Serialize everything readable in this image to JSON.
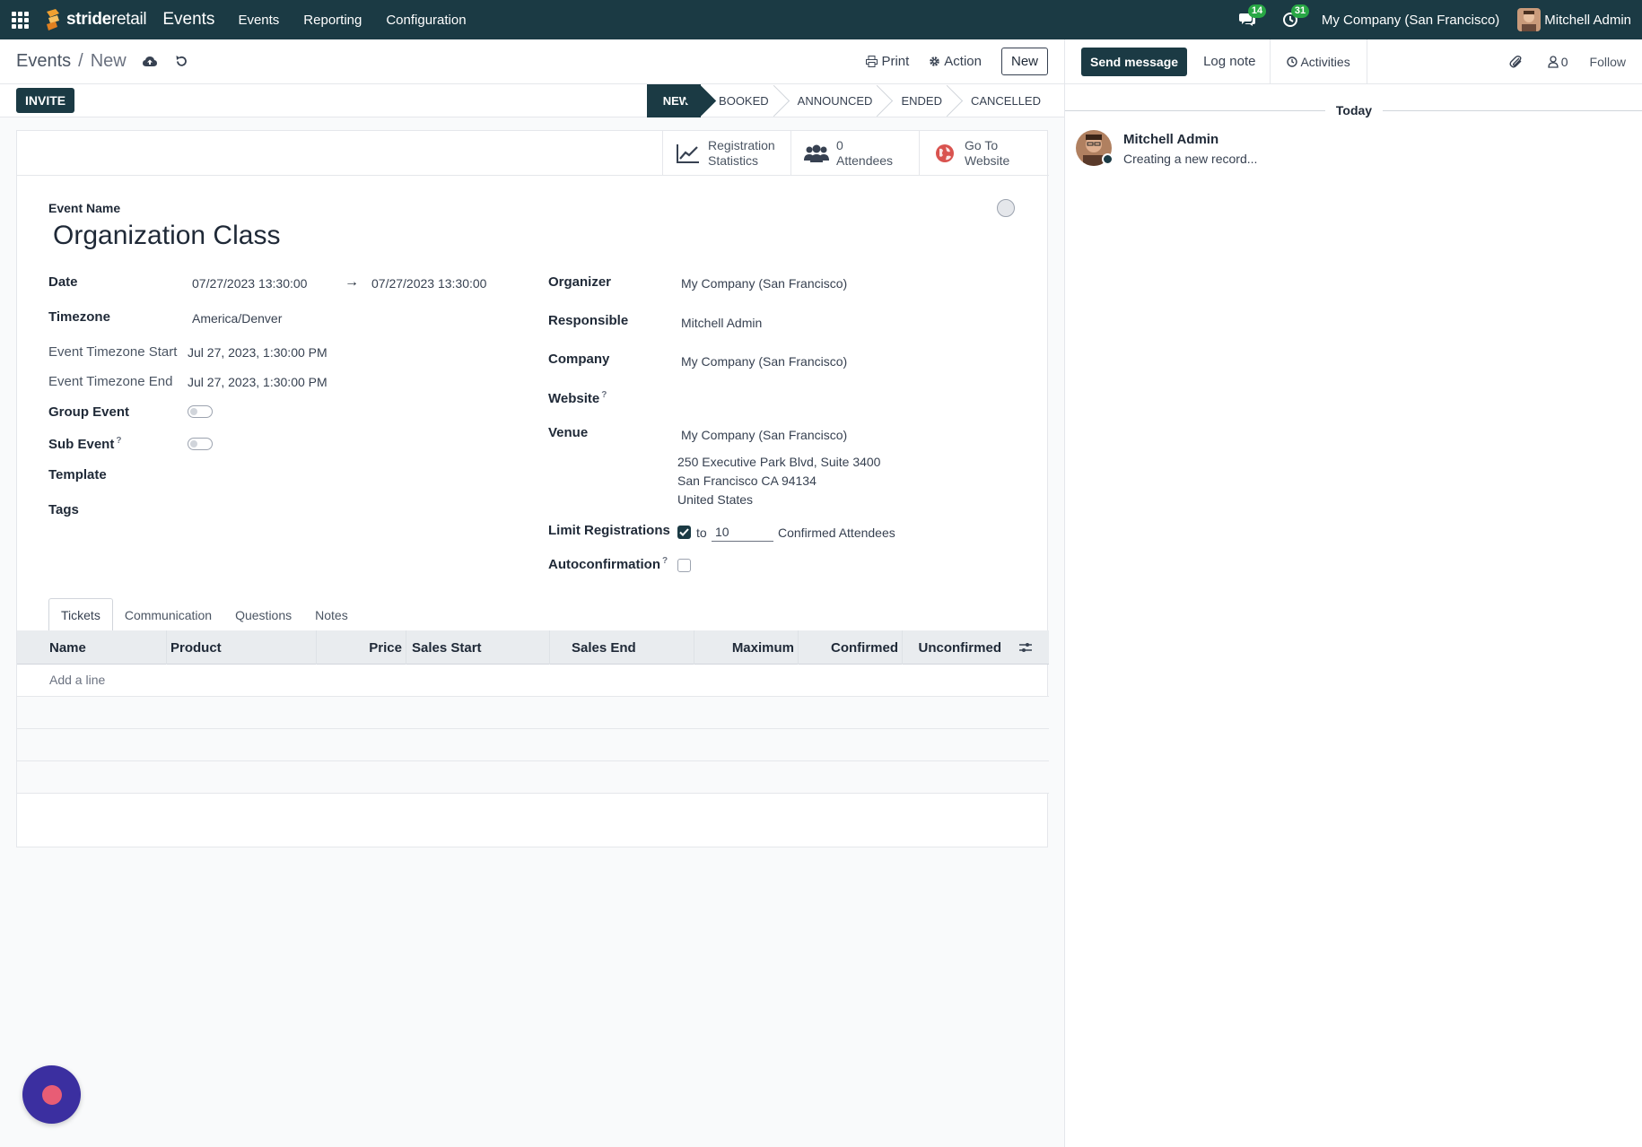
{
  "topbar": {
    "brand": "strideretail",
    "brand_part1": "stride",
    "brand_part2": "retail",
    "app_name": "Events",
    "menu": [
      "Events",
      "Reporting",
      "Configuration"
    ],
    "messages_count": "14",
    "activities_count": "31",
    "company": "My Company (San Francisco)",
    "user": "Mitchell Admin"
  },
  "control": {
    "breadcrumb_parent": "Events",
    "breadcrumb_sep": "/",
    "breadcrumb_current": "New",
    "print_label": "Print",
    "action_label": "Action",
    "new_label": "New"
  },
  "statusbar": {
    "invite_label": "INVITE",
    "stages": [
      "NEW",
      "BOOKED",
      "ANNOUNCED",
      "ENDED",
      "CANCELLED"
    ],
    "active_stage": "NEW"
  },
  "smart_buttons": {
    "stats_line1": "Registration",
    "stats_line2": "Statistics",
    "attendees_line1": "0",
    "attendees_line2": "Attendees",
    "website_line1": "Go To",
    "website_line2": "Website"
  },
  "form": {
    "event_name_label": "Event Name",
    "event_name": "Organization Class",
    "date_label": "Date",
    "date_start": "07/27/2023 13:30:00",
    "date_arrow": "→",
    "date_end": "07/27/2023 13:30:00",
    "timezone_label": "Timezone",
    "timezone": "America/Denver",
    "tz_start_label": "Event Timezone Start",
    "tz_start": "Jul 27, 2023, 1:30:00 PM",
    "tz_end_label": "Event Timezone End",
    "tz_end": "Jul 27, 2023, 1:30:00 PM",
    "group_event_label": "Group Event",
    "group_event": false,
    "sub_event_label": "Sub Event",
    "sub_event": false,
    "template_label": "Template",
    "tags_label": "Tags",
    "organizer_label": "Organizer",
    "organizer": "My Company (San Francisco)",
    "responsible_label": "Responsible",
    "responsible": "Mitchell Admin",
    "company_label": "Company",
    "company": "My Company (San Francisco)",
    "website_label": "Website",
    "venue_label": "Venue",
    "venue": "My Company (San Francisco)",
    "venue_address": [
      "250 Executive Park Blvd, Suite 3400",
      "San Francisco CA 94134",
      "United States"
    ],
    "limit_label": "Limit Registrations",
    "limit_enabled": true,
    "limit_to": "to",
    "limit_value": "10",
    "limit_suffix": "Confirmed Attendees",
    "autoconfirm_label": "Autoconfirmation",
    "autoconfirm": false,
    "help_mark": "?"
  },
  "tabs": [
    "Tickets",
    "Communication",
    "Questions",
    "Notes"
  ],
  "active_tab": "Tickets",
  "tickets_table": {
    "columns": [
      "Name",
      "Product",
      "Price",
      "Sales Start",
      "Sales End",
      "Maximum",
      "Confirmed",
      "Unconfirmed"
    ],
    "add_line": "Add a line",
    "rows": []
  },
  "chatter": {
    "send_message": "Send message",
    "log_note": "Log note",
    "activities": "Activities",
    "followers_count": "0",
    "follow": "Follow",
    "date_separator": "Today",
    "messages": [
      {
        "author": "Mitchell Admin",
        "body": "Creating a new record..."
      }
    ]
  },
  "colors": {
    "brand_dark": "#1b3a44",
    "badge_green": "#28a745",
    "fab_bg": "#3b2fa0",
    "fab_dot": "#e85d75"
  }
}
